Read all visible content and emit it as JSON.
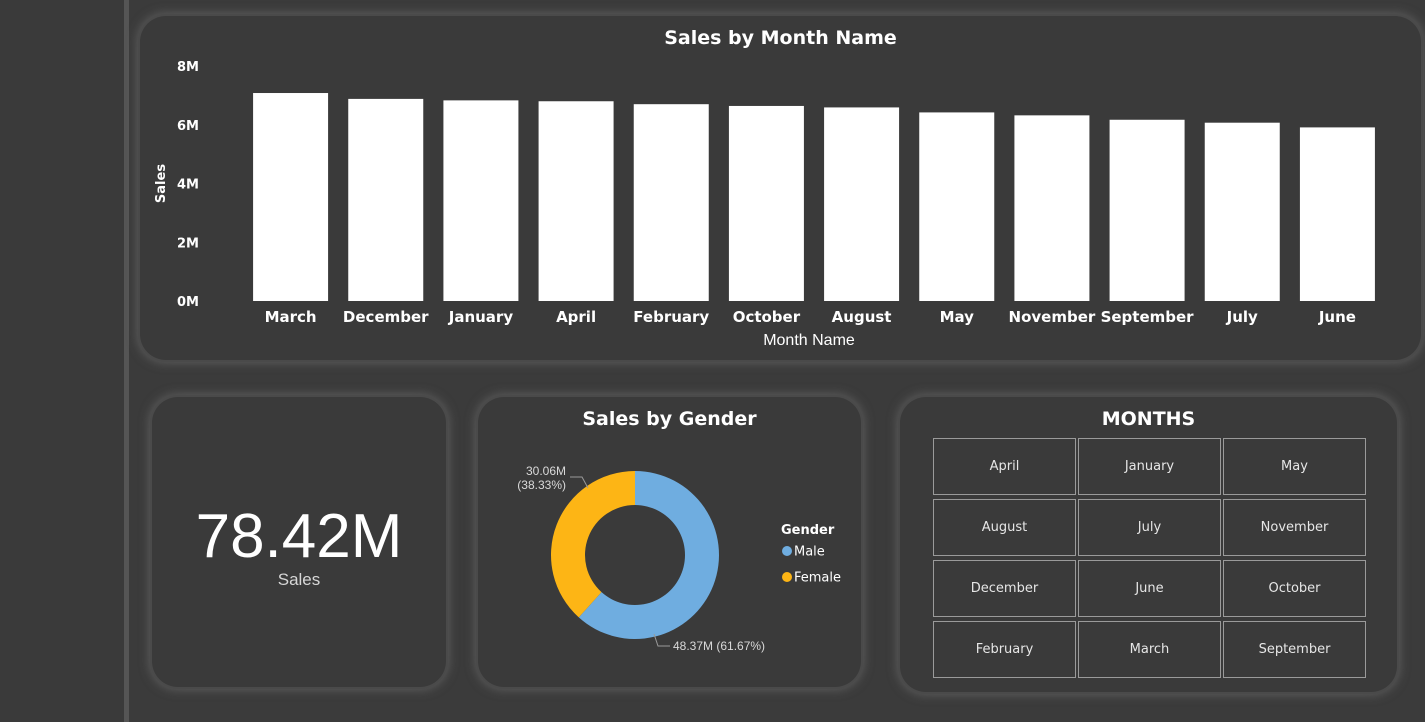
{
  "kpi": {
    "value": "78.42M",
    "label": "Sales"
  },
  "chart_data": [
    {
      "type": "bar",
      "title": "Sales by Month Name",
      "xlabel": "Month Name",
      "ylabel": "Sales",
      "categories": [
        "March",
        "December",
        "January",
        "April",
        "February",
        "October",
        "August",
        "May",
        "November",
        "September",
        "July",
        "June"
      ],
      "values": [
        7.08,
        6.88,
        6.83,
        6.8,
        6.7,
        6.64,
        6.59,
        6.42,
        6.32,
        6.17,
        6.07,
        5.91
      ],
      "value_unit": "M",
      "ylim": [
        0,
        8
      ],
      "yticks": [
        "0M",
        "2M",
        "4M",
        "6M",
        "8M"
      ],
      "grid": false,
      "bar_color": "#ffffff"
    },
    {
      "type": "pie",
      "style": "donut",
      "title": "Sales by Gender",
      "legend_title": "Gender",
      "legend_position": "right",
      "slices": [
        {
          "name": "Male",
          "value": 48.37,
          "percent": 61.67,
          "label": "48.37M (61.67%)",
          "color": "#6FADE0"
        },
        {
          "name": "Female",
          "value": 30.06,
          "percent": 38.33,
          "label_line1": "30.06M",
          "label_line2": "(38.33%)",
          "color": "#FDB515"
        }
      ]
    }
  ],
  "slicer": {
    "title": "MONTHS",
    "items": [
      "April",
      "January",
      "May",
      "August",
      "July",
      "November",
      "December",
      "June",
      "October",
      "February",
      "March",
      "September"
    ]
  }
}
